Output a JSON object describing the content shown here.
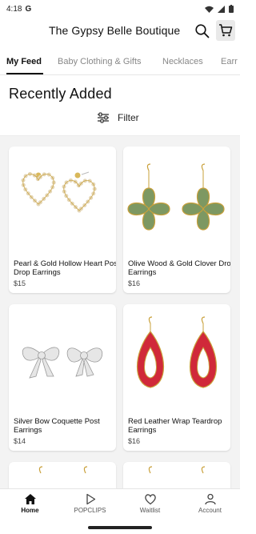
{
  "status_bar": {
    "time": "4:18",
    "g_icon": "G"
  },
  "header": {
    "store_name": "The Gypsy Belle Boutique"
  },
  "tabs": [
    {
      "label": "My Feed"
    },
    {
      "label": "Baby Clothing & Gifts"
    },
    {
      "label": "Necklaces"
    },
    {
      "label": "Earr"
    }
  ],
  "section": {
    "title": "Recently Added",
    "filter_label": "Filter"
  },
  "products": [
    {
      "name": "Pearl & Gold Hollow Heart Post Drop Earrings",
      "price": "$15"
    },
    {
      "name": "Olive Wood & Gold Clover Drop Earrings",
      "price": "$16"
    },
    {
      "name": "Silver Bow Coquette Post Earrings",
      "price": "$14"
    },
    {
      "name": "Red Leather Wrap Teardrop Earrings",
      "price": "$16"
    }
  ],
  "nav": [
    {
      "label": "Home",
      "icon": "home-icon"
    },
    {
      "label": "POPCLIPS",
      "icon": "play-icon"
    },
    {
      "label": "Waitlist",
      "icon": "heart-icon"
    },
    {
      "label": "Account",
      "icon": "person-icon"
    }
  ],
  "colors": {
    "accent": "#111111",
    "earring_red": "#d0293a",
    "earring_green": "#7d9862",
    "gold": "#c9a03a"
  }
}
